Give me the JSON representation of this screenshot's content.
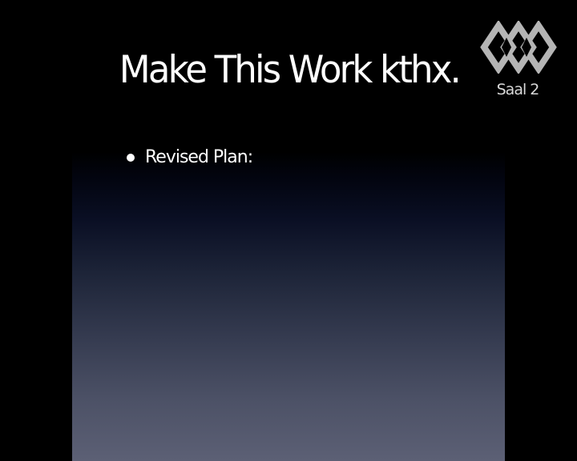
{
  "slide": {
    "title": "Make This Work kthx.",
    "bullets": [
      "Revised Plan:"
    ]
  },
  "channel_overlay": {
    "logo_icon": "ccc-logo-icon",
    "label": "Saal 2"
  },
  "colors": {
    "background": "#000000",
    "text": "#ffffff",
    "gradient_top": "#000000",
    "gradient_bottom": "#5c6075",
    "logo": "#b8b8b8"
  }
}
